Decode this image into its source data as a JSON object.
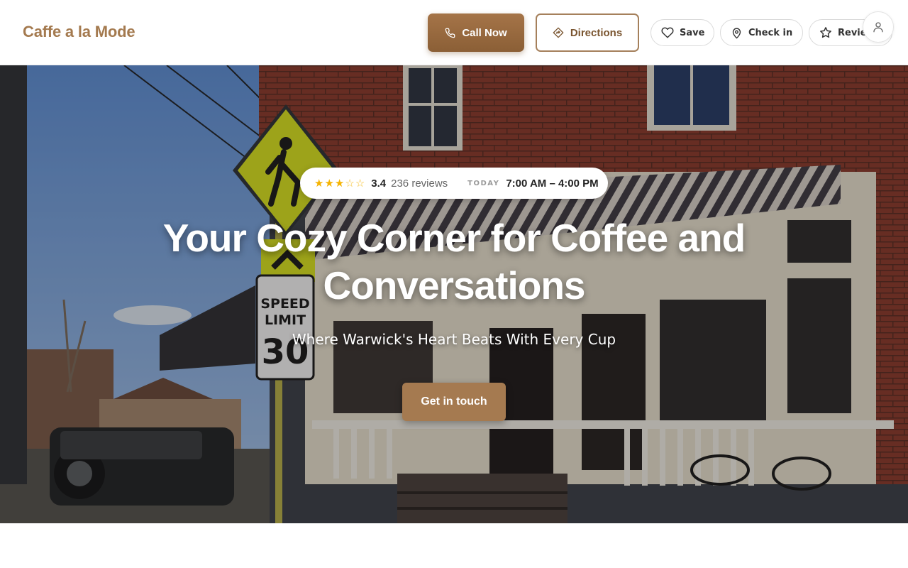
{
  "header": {
    "brand": "Caffe a la Mode",
    "call_label": "Call Now",
    "directions_label": "Directions",
    "save_label": "Save",
    "checkin_label": "Check in",
    "review_label": "Review",
    "brand_color": "#a47a4f",
    "primary_color": "#9a6b40"
  },
  "hero": {
    "rating": "3.4",
    "rating_stars": 3.4,
    "reviews": "236 reviews",
    "today_label": "TODAY",
    "hours": "7:00 AM – 4:00 PM",
    "headline": "Your Cozy Corner for Coffee and Conversations",
    "subheadline": "Where Warwick's Heart Beats With Every Cup",
    "cta_label": "Get in touch"
  },
  "icons": {
    "call": "phone-icon",
    "directions": "directions-icon",
    "save": "heart-icon",
    "checkin": "map-pin-icon",
    "review": "star-icon",
    "account": "user-icon"
  }
}
